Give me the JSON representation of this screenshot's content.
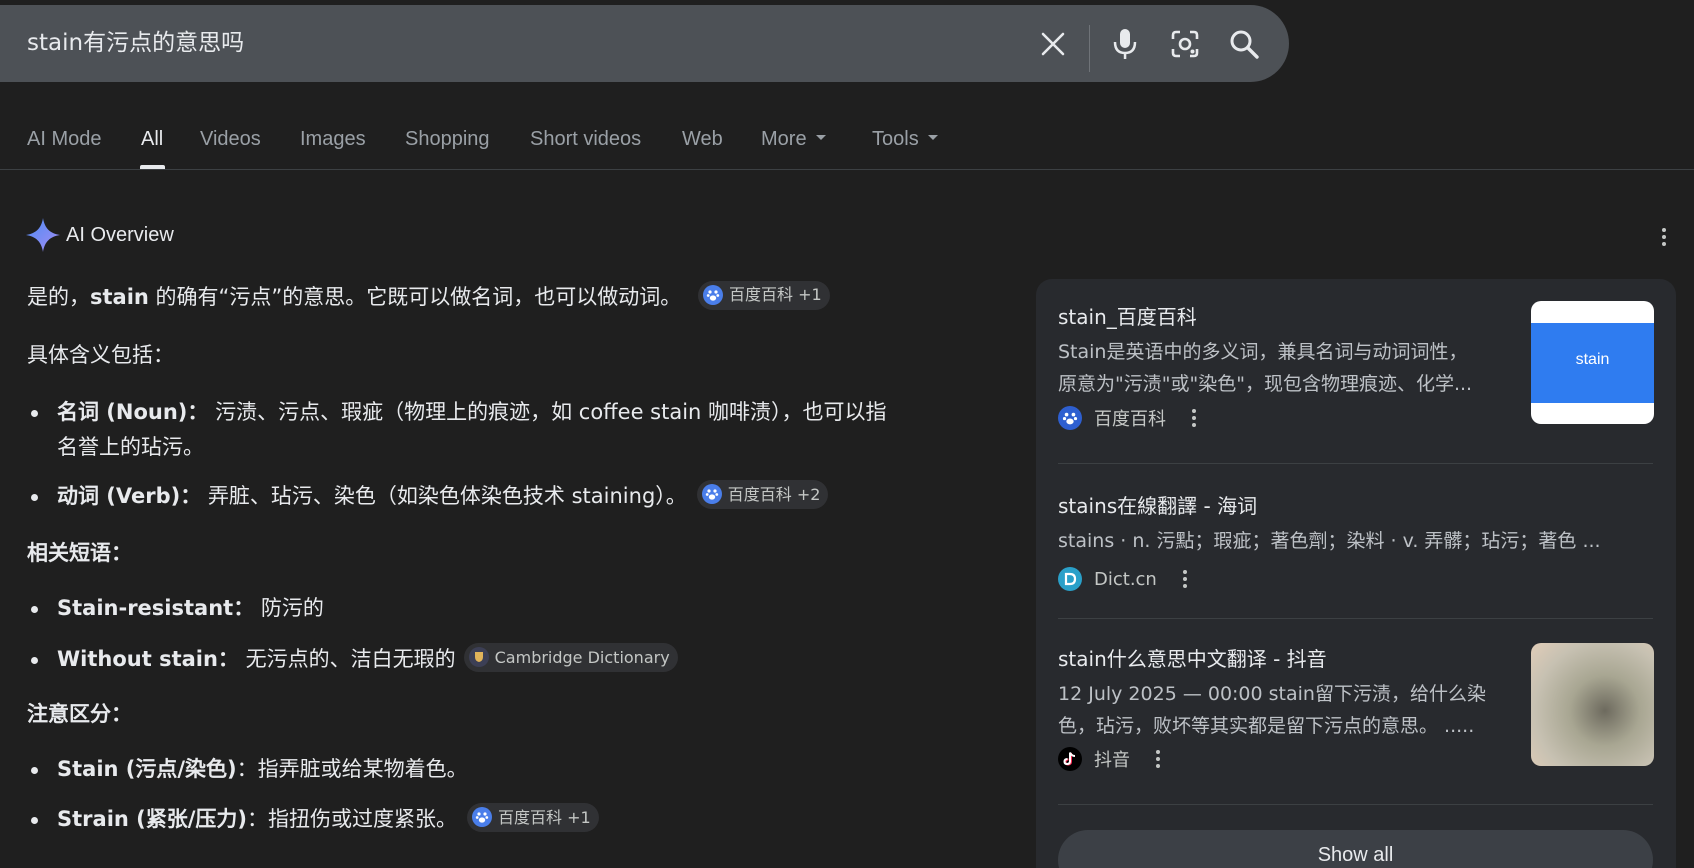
{
  "search": {
    "query": "stain有污点的意思吗",
    "icons": [
      "close-icon",
      "mic-icon",
      "lens-icon",
      "search-icon"
    ]
  },
  "tabs": [
    {
      "label": "AI Mode",
      "active": false
    },
    {
      "label": "All",
      "active": true
    },
    {
      "label": "Videos",
      "active": false
    },
    {
      "label": "Images",
      "active": false
    },
    {
      "label": "Shopping",
      "active": false
    },
    {
      "label": "Short videos",
      "active": false
    },
    {
      "label": "Web",
      "active": false
    },
    {
      "label": "More",
      "active": false
    },
    {
      "label": "Tools",
      "active": false
    }
  ],
  "ai_overview": {
    "label": "AI Overview",
    "intro_pre": "是的，",
    "intro_bold": "stain",
    "intro_post": " 的确有“污点”的意思。它既可以做名词，也可以做动词。",
    "intro_chip": "百度百科 +1",
    "meanings_heading": "具体含义包括：",
    "noun_term": "名词 (Noun)：",
    "noun_def_line1": "污渍、污点、瑕疵（物理上的痕迹，如 coffee stain 咖啡渍），也可以指",
    "noun_def_line2": "名誉上的玷污。",
    "verb_term": "动词 (Verb)：",
    "verb_def": "弄脏、玷污、染色（如染色体染色技术 staining）。",
    "verb_chip": "百度百科 +2",
    "phrases_heading": "相关短语：",
    "phrase1_term": "Stain-resistant：",
    "phrase1_def": "防污的",
    "phrase2_term": "Without stain：",
    "phrase2_def": "无污点的、洁白无瑕的",
    "phrase2_chip": "Cambridge Dictionary",
    "distinguish_heading": "注意区分：",
    "dist1_term": "Stain (污点/染色)",
    "dist1_def": "：指弄脏或给某物着色。",
    "dist2_term": "Strain (紧张/压力)",
    "dist2_def": "：指扭伤或过度紧张。",
    "dist2_chip": "百度百科 +1"
  },
  "sources": [
    {
      "title": "stain_百度百科",
      "snippet_line1": "Stain是英语中的多义词，兼具名词与动词词性，",
      "snippet_line2": "原意为\"污渍\"或\"染色\"，现包含物理痕迹、化学...",
      "source": "百度百科",
      "thumb_text": "stain"
    },
    {
      "title": "stains在線翻譯 - 海词",
      "snippet_line1": "stains · n. 污點；瑕疵；著色劑；染料 · v. 弄髒；玷污；著色 ...",
      "source": "Dict.cn"
    },
    {
      "title": "stain什么意思中文翻译 - 抖音",
      "snippet_line1": "12 July 2025 — 00:00 stain留下污渍，给什么染",
      "snippet_line2": "色，玷污，败坏等其实都是留下污点的意思。 .....",
      "source": "抖音"
    }
  ],
  "show_all_label": "Show all",
  "colors": {
    "background": "#1f1f1f",
    "search_bar": "#4d5156",
    "panel": "#282a2e",
    "chip": "#303134",
    "accent_blue": "#4a7eea"
  }
}
